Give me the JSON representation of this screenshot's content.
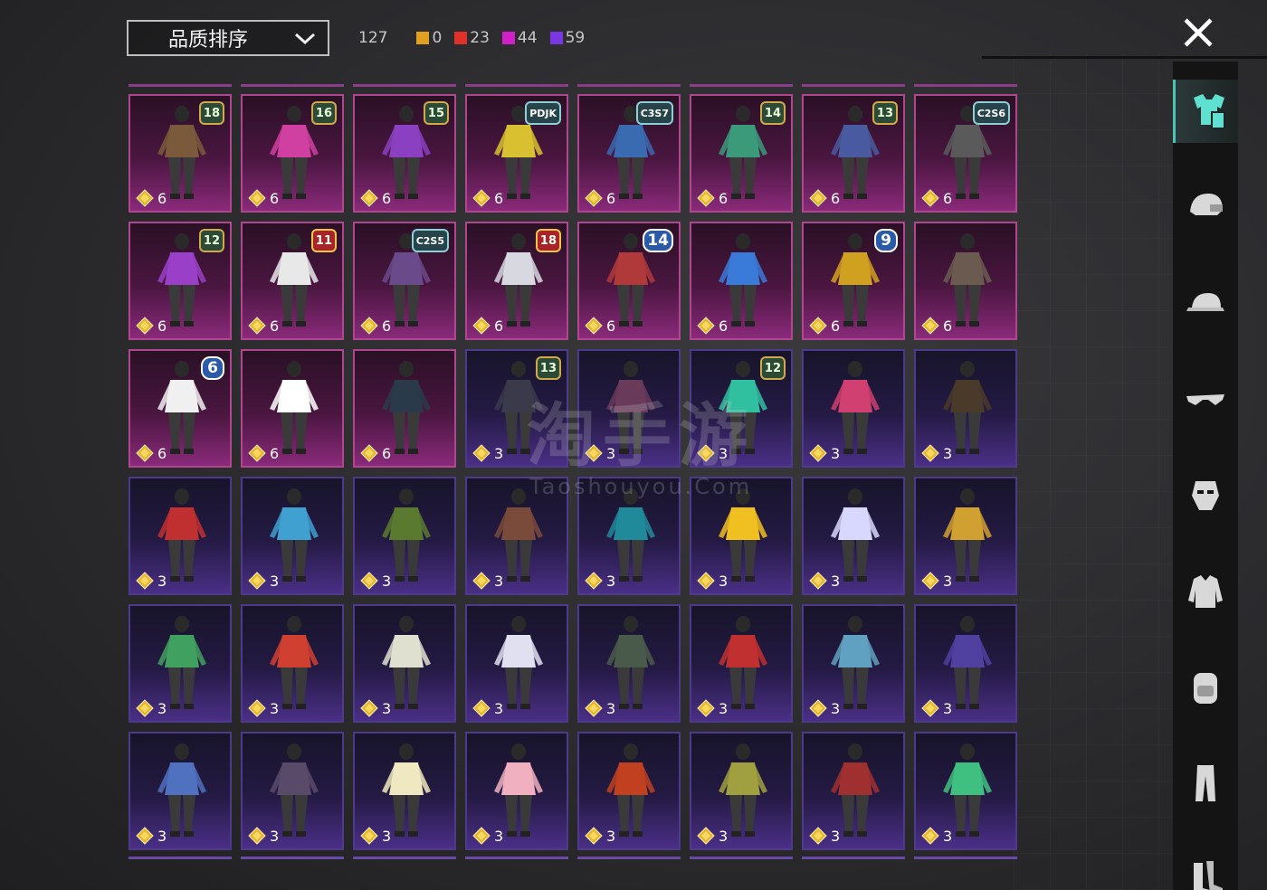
{
  "sort": {
    "label": "品质排序"
  },
  "counts": {
    "total": "127",
    "items": [
      {
        "color": "#e0a020",
        "value": "0"
      },
      {
        "color": "#e0302a",
        "value": "23"
      },
      {
        "color": "#d020c8",
        "value": "44"
      },
      {
        "color": "#7a36e0",
        "value": "59"
      }
    ]
  },
  "watermark": {
    "cn": "淘手游",
    "en": "Taoshouyou.Com"
  },
  "grid": {
    "cards": [
      {
        "rarity": "legendary",
        "badge": "18",
        "badge_style": "",
        "price": "6"
      },
      {
        "rarity": "legendary",
        "badge": "16",
        "badge_style": "",
        "price": "6"
      },
      {
        "rarity": "legendary",
        "badge": "15",
        "badge_style": "",
        "price": "6"
      },
      {
        "rarity": "legendary",
        "badge": "PDJK",
        "badge_style": "season",
        "price": "6"
      },
      {
        "rarity": "legendary",
        "badge": "C3S7",
        "badge_style": "season",
        "price": "6"
      },
      {
        "rarity": "legendary",
        "badge": "14",
        "badge_style": "",
        "price": "6"
      },
      {
        "rarity": "legendary",
        "badge": "13",
        "badge_style": "",
        "price": "6"
      },
      {
        "rarity": "legendary",
        "badge": "C2S6",
        "badge_style": "season",
        "price": "6"
      },
      {
        "rarity": "legendary",
        "badge": "12",
        "badge_style": "",
        "price": "6"
      },
      {
        "rarity": "legendary",
        "badge": "11",
        "badge_style": "red",
        "price": "6"
      },
      {
        "rarity": "legendary",
        "badge": "C2S5",
        "badge_style": "season",
        "price": "6"
      },
      {
        "rarity": "legendary",
        "badge": "18",
        "badge_style": "red",
        "price": "6"
      },
      {
        "rarity": "legendary",
        "badge": "14",
        "badge_style": "big",
        "price": "6"
      },
      {
        "rarity": "legendary",
        "badge": "",
        "badge_style": "",
        "price": "6"
      },
      {
        "rarity": "legendary",
        "badge": "9",
        "badge_style": "big",
        "price": "6"
      },
      {
        "rarity": "legendary",
        "badge": "",
        "badge_style": "",
        "price": "6"
      },
      {
        "rarity": "legendary",
        "badge": "6",
        "badge_style": "big",
        "price": "6"
      },
      {
        "rarity": "legendary",
        "badge": "",
        "badge_style": "",
        "price": "6"
      },
      {
        "rarity": "legendary",
        "badge": "",
        "badge_style": "",
        "price": "6"
      },
      {
        "rarity": "epic",
        "badge": "13",
        "badge_style": "",
        "price": "3"
      },
      {
        "rarity": "epic",
        "badge": "",
        "badge_style": "",
        "price": "3"
      },
      {
        "rarity": "epic",
        "badge": "12",
        "badge_style": "",
        "price": "3"
      },
      {
        "rarity": "epic",
        "badge": "",
        "badge_style": "",
        "price": "3"
      },
      {
        "rarity": "epic",
        "badge": "",
        "badge_style": "",
        "price": "3"
      },
      {
        "rarity": "epic",
        "badge": "",
        "badge_style": "",
        "price": "3"
      },
      {
        "rarity": "epic",
        "badge": "",
        "badge_style": "",
        "price": "3"
      },
      {
        "rarity": "epic",
        "badge": "",
        "badge_style": "",
        "price": "3"
      },
      {
        "rarity": "epic",
        "badge": "",
        "badge_style": "",
        "price": "3"
      },
      {
        "rarity": "epic",
        "badge": "",
        "badge_style": "",
        "price": "3"
      },
      {
        "rarity": "epic",
        "badge": "",
        "badge_style": "",
        "price": "3"
      },
      {
        "rarity": "epic",
        "badge": "",
        "badge_style": "",
        "price": "3"
      },
      {
        "rarity": "epic",
        "badge": "",
        "badge_style": "",
        "price": "3"
      },
      {
        "rarity": "epic",
        "badge": "",
        "badge_style": "",
        "price": "3"
      },
      {
        "rarity": "epic",
        "badge": "",
        "badge_style": "",
        "price": "3"
      },
      {
        "rarity": "epic",
        "badge": "",
        "badge_style": "",
        "price": "3"
      },
      {
        "rarity": "epic",
        "badge": "",
        "badge_style": "",
        "price": "3"
      },
      {
        "rarity": "epic",
        "badge": "",
        "badge_style": "",
        "price": "3"
      },
      {
        "rarity": "epic",
        "badge": "",
        "badge_style": "",
        "price": "3"
      },
      {
        "rarity": "epic",
        "badge": "",
        "badge_style": "",
        "price": "3"
      },
      {
        "rarity": "epic",
        "badge": "",
        "badge_style": "",
        "price": "3"
      },
      {
        "rarity": "epic",
        "badge": "",
        "badge_style": "",
        "price": "3"
      },
      {
        "rarity": "epic",
        "badge": "",
        "badge_style": "",
        "price": "3"
      },
      {
        "rarity": "epic",
        "badge": "",
        "badge_style": "",
        "price": "3"
      },
      {
        "rarity": "epic",
        "badge": "",
        "badge_style": "",
        "price": "3"
      },
      {
        "rarity": "epic",
        "badge": "",
        "badge_style": "",
        "price": "3"
      },
      {
        "rarity": "epic",
        "badge": "",
        "badge_style": "",
        "price": "3"
      },
      {
        "rarity": "epic",
        "badge": "",
        "badge_style": "",
        "price": "3"
      },
      {
        "rarity": "epic",
        "badge": "",
        "badge_style": "",
        "price": "3"
      }
    ],
    "outfit_colors": [
      "#7a5a3a",
      "#d040a0",
      "#8a40c0",
      "#d8c030",
      "#3a6ab0",
      "#3a9a7a",
      "#4a5aa0",
      "#5a5a5a",
      "#9a40c8",
      "#e8e8e8",
      "#6a4a8a",
      "#d8d8e0",
      "#b03a3a",
      "#3a7ad8",
      "#d0a020",
      "#6a5a50",
      "#f0f0f0",
      "#ffffff",
      "#2a3a4a",
      "#3a3a4a",
      "#6a3a5a",
      "#30c0a0",
      "#d04070",
      "#4a3a2a",
      "#c03030",
      "#40a0d0",
      "#5a7a30",
      "#7a4a3a",
      "#208a9a",
      "#f0c020",
      "#d8d8ff",
      "#d0a030",
      "#40a060",
      "#d04030",
      "#e0e0d0",
      "#e0e0f0",
      "#4a5a4a",
      "#c03030",
      "#60a0c0",
      "#5040a0",
      "#5070c0",
      "#5a4a6a",
      "#f0e8c0",
      "#f0b0c0",
      "#c04020",
      "#a0a040",
      "#a03030",
      "#40c080"
    ]
  },
  "sidebar": {
    "items": [
      {
        "icon": "outfit-icon",
        "active": true
      },
      {
        "icon": "helmet-icon",
        "active": false
      },
      {
        "icon": "cap-icon",
        "active": false
      },
      {
        "icon": "glasses-icon",
        "active": false
      },
      {
        "icon": "mask-icon",
        "active": false
      },
      {
        "icon": "jacket-icon",
        "active": false
      },
      {
        "icon": "backpack-icon",
        "active": false
      },
      {
        "icon": "pants-icon",
        "active": false
      },
      {
        "icon": "boots-icon",
        "active": false
      }
    ]
  }
}
